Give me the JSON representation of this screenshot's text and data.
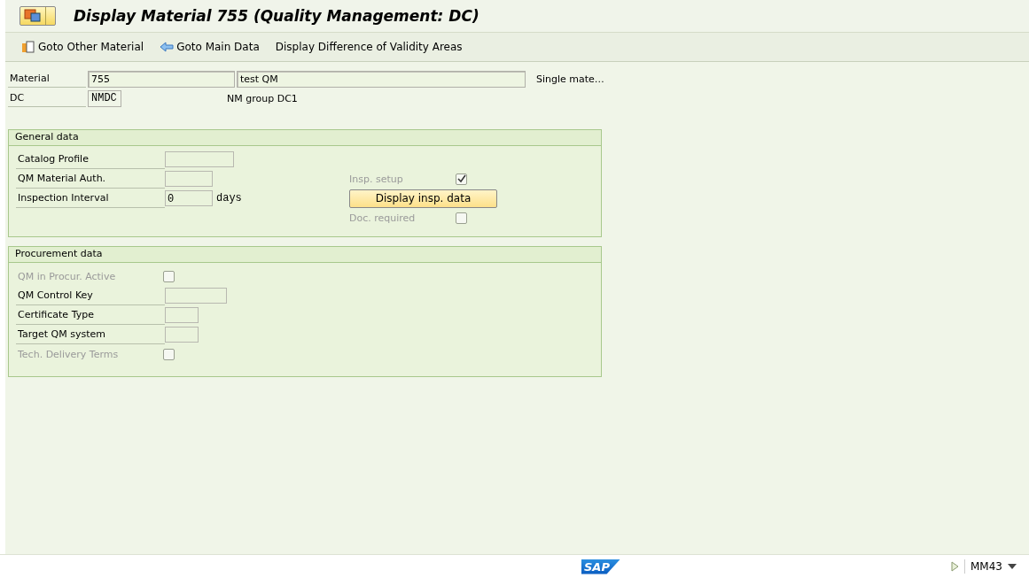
{
  "window": {
    "title": "Display Material 755 (Quality Management: DC)"
  },
  "toolbar": [
    {
      "kind": "other",
      "label": "Goto Other Material"
    },
    {
      "kind": "back",
      "label": "Goto Main Data"
    },
    {
      "kind": "plain",
      "label": "Display Difference of Validity Areas"
    }
  ],
  "header": {
    "material": {
      "label": "Material",
      "value": "755",
      "description": "test QM",
      "type": "Single mate…"
    },
    "dc": {
      "label": "DC",
      "value": "NMDC",
      "description": "NM group DC1"
    }
  },
  "sections": [
    {
      "title": "General data",
      "rows": [
        {
          "left": {
            "kind": "field",
            "label": "Catalog Profile"
          }
        },
        {
          "left": {
            "kind": "field",
            "label": "QM Material Auth."
          },
          "right": {
            "kind": "checkbox",
            "label": "Insp. setup",
            "checked": true,
            "disabled": true
          }
        },
        {
          "left": {
            "kind": "field",
            "label": "Inspection Interval",
            "value": "0",
            "unit": "days"
          },
          "right": {
            "kind": "button",
            "label": "Display insp. data"
          }
        },
        {
          "right": {
            "kind": "checkbox",
            "label": "Doc. required",
            "checked": false,
            "disabled": true
          }
        }
      ]
    },
    {
      "title": "Procurement data",
      "rows": [
        {
          "left": {
            "kind": "checkbox",
            "label": "QM in Procur. Active",
            "checked": false,
            "disabled": true
          }
        },
        {
          "left": {
            "kind": "field",
            "label": "QM Control Key"
          }
        },
        {
          "left": {
            "kind": "field",
            "label": "Certificate Type"
          }
        },
        {
          "left": {
            "kind": "field",
            "label": "Target QM system"
          }
        },
        {
          "left": {
            "kind": "checkbox",
            "label": "Tech. Delivery Terms",
            "checked": false,
            "disabled": true
          }
        }
      ]
    }
  ],
  "status_bar": {
    "logo": "SAP",
    "transaction": "MM43"
  }
}
